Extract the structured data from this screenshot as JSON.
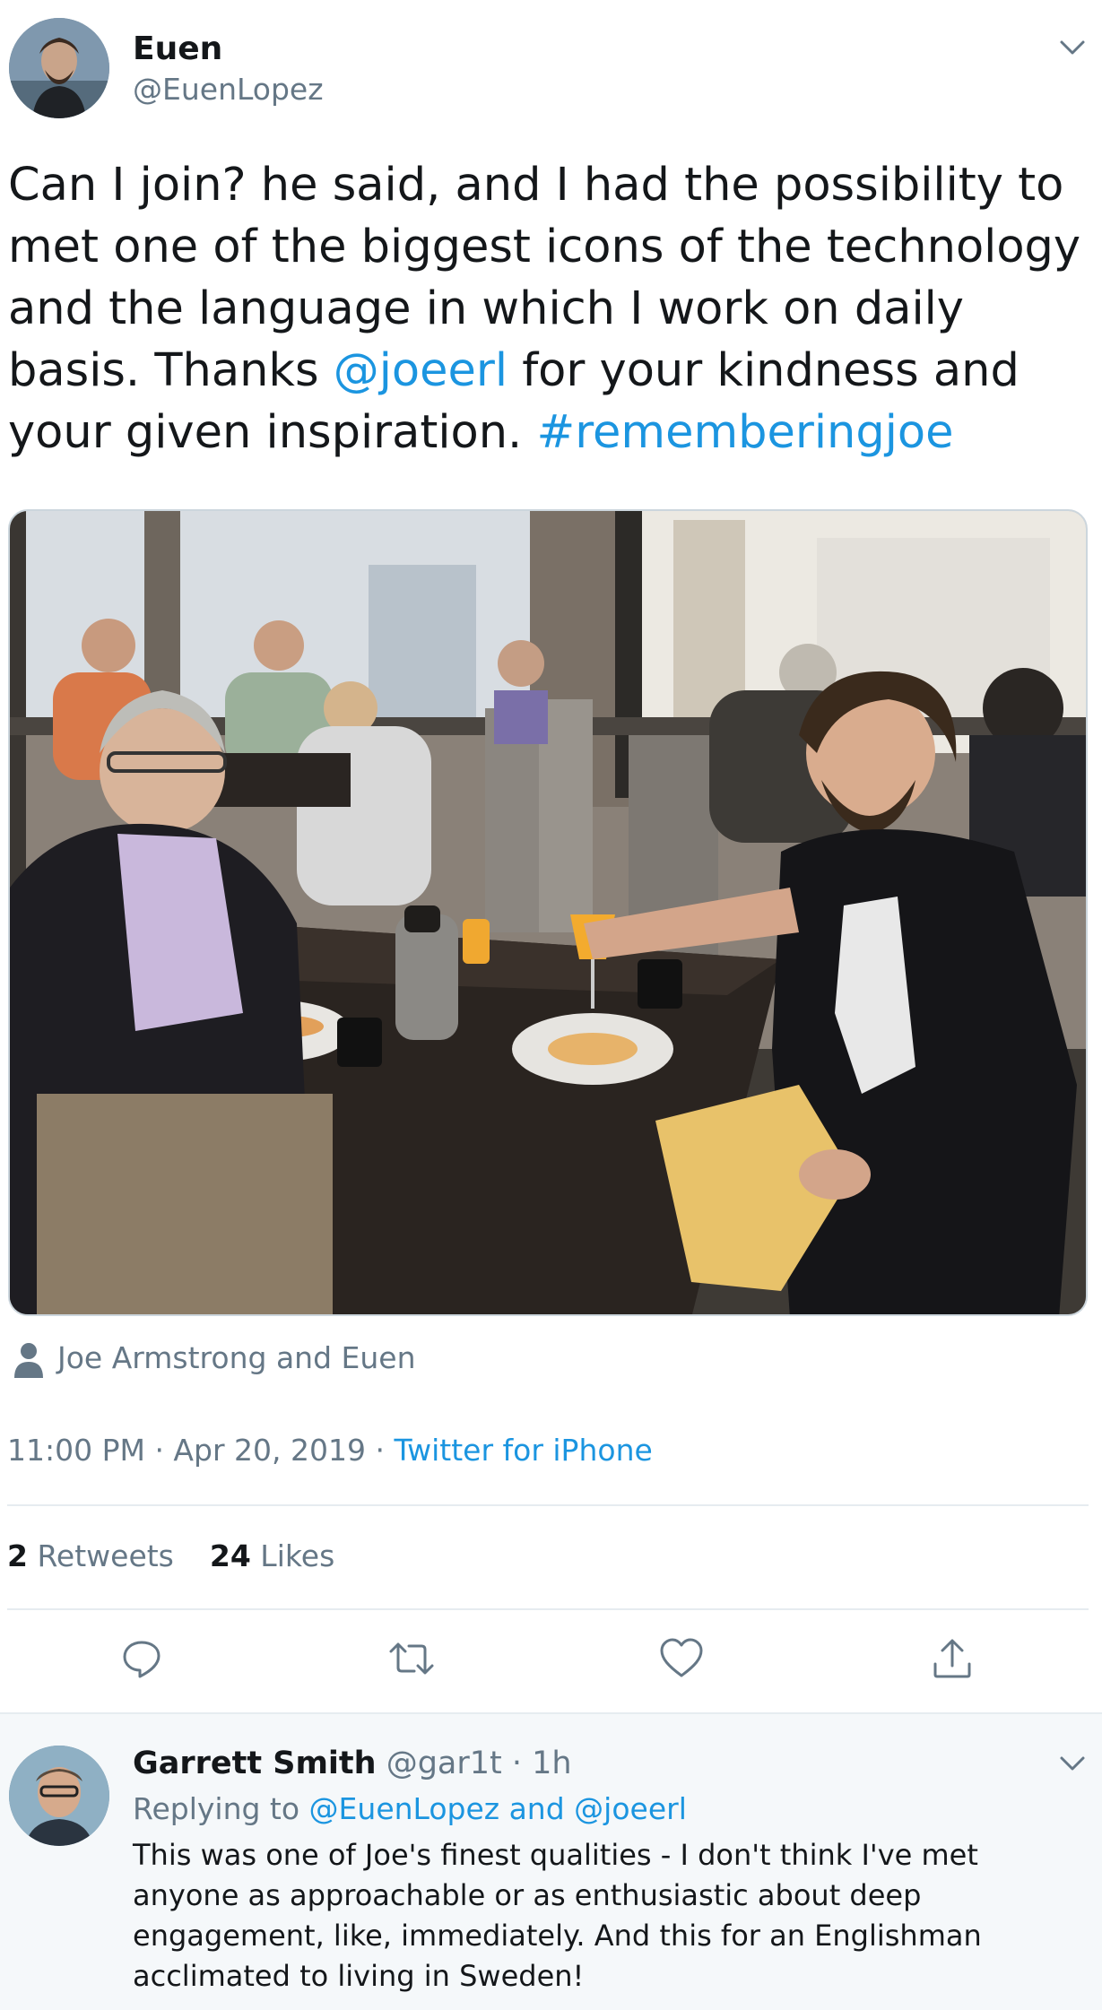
{
  "tweet": {
    "author": {
      "name": "Euen",
      "handle": "@EuenLopez"
    },
    "text": {
      "part1": "Can I join? he said, and I had the possibility to met one of the biggest icons of the technology and the language in which I work on daily basis. Thanks ",
      "mention": "@joeerl",
      "part2": " for your kindness and your given inspiration. ",
      "hashtag": "#rememberingjoe"
    },
    "tagged_people": "Joe Armstrong and Euen",
    "timestamp": "11:00 PM · Apr 20, 2019 · ",
    "source": "Twitter for iPhone",
    "stats": {
      "retweets_count": "2",
      "retweets_label": " Retweets",
      "likes_count": "24",
      "likes_label": " Likes"
    },
    "actions": [
      "reply-icon",
      "retweet-icon",
      "like-icon",
      "share-icon"
    ]
  },
  "reply": {
    "author_name": "Garrett Smith",
    "meta": " @gar1t · 1h",
    "replying_prefix": "Replying to ",
    "replying_links": "@EuenLopez and @joeerl",
    "text": "This was one of Joe's finest qualities - I don't think I've met anyone as approachable or as enthusiastic about deep engagement, like, immediately. And this for an Englishman acclimated to living in Sweden!"
  },
  "colors": {
    "link": "#1b95e0",
    "secondary_text": "#657786",
    "primary_text": "#14171a",
    "divider": "#e6ecf0",
    "reply_background": "#f5f8fa"
  }
}
